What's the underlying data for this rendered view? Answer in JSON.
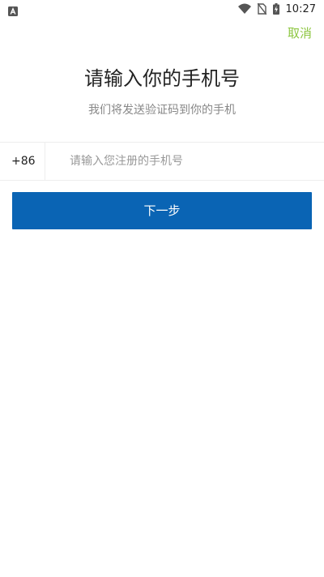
{
  "status_bar": {
    "time": "10:27",
    "icons": [
      "notification-a-icon",
      "wifi-icon",
      "no-sim-icon",
      "battery-charging-icon"
    ]
  },
  "header": {
    "cancel_label": "取消"
  },
  "main": {
    "title": "请输入你的手机号",
    "subtitle": "我们将发送验证码到你的手机",
    "country_code": "+86",
    "phone_placeholder": "请输入您注册的手机号",
    "phone_value": "",
    "next_label": "下一步"
  },
  "colors": {
    "accent_green": "#8cc63f",
    "button_blue": "#0a64b4"
  }
}
